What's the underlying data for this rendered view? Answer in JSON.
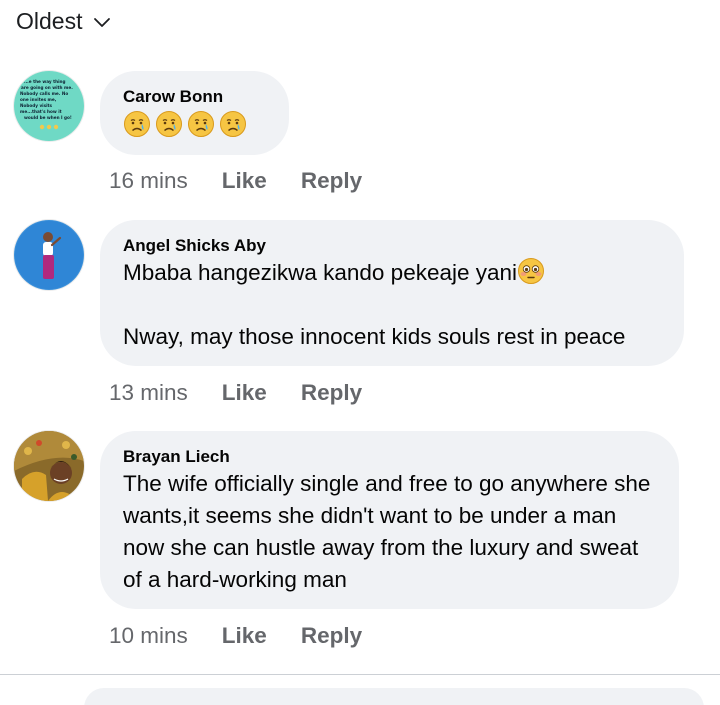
{
  "sort": {
    "label": "Oldest",
    "icon": "chevron-down-icon"
  },
  "comments": [
    {
      "author": "Carow Bonn",
      "text": "",
      "emojis": [
        "crying-face",
        "crying-face",
        "crying-face",
        "crying-face"
      ],
      "avatar_text": "...e the way thing are going on with me. Nobody calls me. No one invites me. Nobody visits me...that's how it would be when I go!",
      "time": "16 mins",
      "like": "Like",
      "reply": "Reply"
    },
    {
      "author": "Angel Shicks Aby",
      "text": "Mbaba hangezikwa kando pekeaje yani",
      "text_emoji": "flushed-face",
      "text2": "Nway, may those innocent kids souls rest in peace",
      "time": "13 mins",
      "like": "Like",
      "reply": "Reply"
    },
    {
      "author": "Brayan Liech",
      "text": "The wife officially single and free to go anywhere she wants,it seems she didn't want to be under a man now she can hustle away from the luxury and sweat of a hard-working man",
      "time": "10 mins",
      "like": "Like",
      "reply": "Reply"
    }
  ],
  "colors": {
    "bubble": "#f0f2f5",
    "meta": "#65676b",
    "text": "#050505"
  }
}
